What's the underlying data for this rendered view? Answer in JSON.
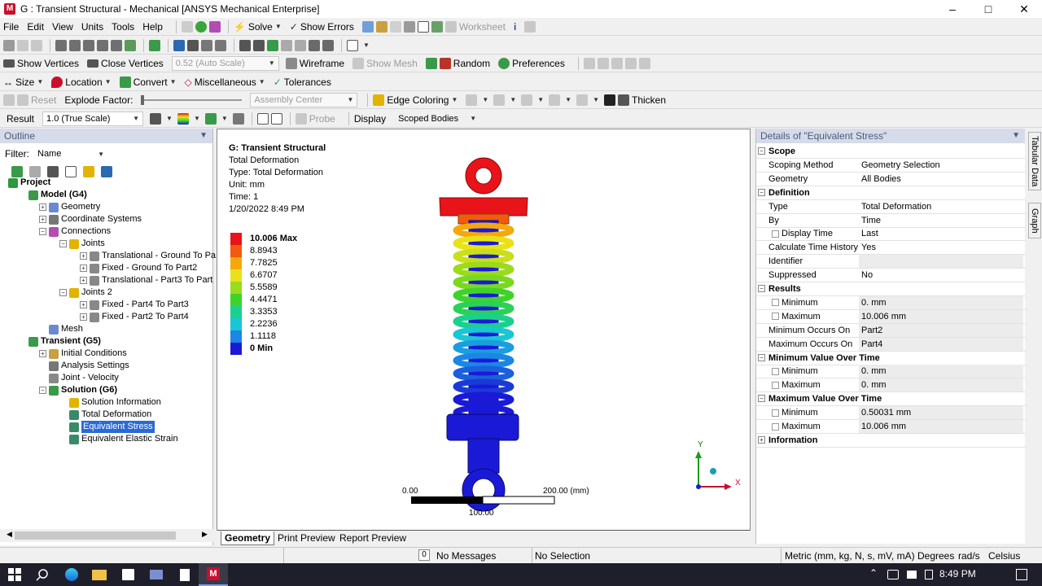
{
  "window": {
    "title": "G : Transient Structural - Mechanical [ANSYS Mechanical Enterprise]",
    "logo_letter": "M"
  },
  "menu": [
    "File",
    "Edit",
    "View",
    "Units",
    "Tools",
    "Help"
  ],
  "toolbar1": {
    "solve": "Solve",
    "show_errors": "Show Errors",
    "worksheet": "Worksheet"
  },
  "toolbar3": {
    "show_vertices": "Show Vertices",
    "close_vertices": "Close Vertices",
    "scale": "0.52 (Auto Scale)",
    "wireframe": "Wireframe",
    "show_mesh": "Show Mesh",
    "random": "Random",
    "preferences": "Preferences"
  },
  "toolbar4": {
    "size": "Size",
    "location": "Location",
    "convert": "Convert",
    "miscellaneous": "Miscellaneous",
    "tolerances": "Tolerances"
  },
  "toolbar5": {
    "reset": "Reset",
    "explode_factor": "Explode Factor:",
    "assembly_center": "Assembly Center",
    "edge_coloring": "Edge Coloring",
    "thicken": "Thicken"
  },
  "toolbar6": {
    "result_label": "Result",
    "result_scale": "1.0 (True Scale)",
    "probe": "Probe",
    "display_label": "Display",
    "display_value": "Scoped Bodies"
  },
  "outline": {
    "header": "Outline",
    "filter_label": "Filter:",
    "filter_value": "Name",
    "items": [
      {
        "label": "Project",
        "bold": true
      },
      {
        "label": "Model (G4)",
        "bold": true
      },
      {
        "label": "Geometry"
      },
      {
        "label": "Coordinate Systems"
      },
      {
        "label": "Connections"
      },
      {
        "label": "Joints"
      },
      {
        "label": "Translational - Ground To Pa"
      },
      {
        "label": "Fixed - Ground To Part2"
      },
      {
        "label": "Translational - Part3 To Part"
      },
      {
        "label": "Joints 2"
      },
      {
        "label": "Fixed - Part4 To Part3"
      },
      {
        "label": "Fixed - Part2 To Part4"
      },
      {
        "label": "Mesh"
      },
      {
        "label": "Transient (G5)",
        "bold": true
      },
      {
        "label": "Initial Conditions"
      },
      {
        "label": "Analysis Settings"
      },
      {
        "label": "Joint - Velocity"
      },
      {
        "label": "Solution (G6)",
        "bold": true
      },
      {
        "label": "Solution Information"
      },
      {
        "label": "Total Deformation"
      },
      {
        "label": "Equivalent Stress",
        "selected": true
      },
      {
        "label": "Equivalent Elastic Strain"
      }
    ]
  },
  "viewport": {
    "info": [
      "G: Transient Structural",
      "Total Deformation",
      "Type: Total Deformation",
      "Unit: mm",
      "Time: 1",
      "1/20/2022 8:49 PM"
    ],
    "legend": [
      {
        "label": "10.006 Max",
        "color": "#e8141a"
      },
      {
        "label": "8.8943",
        "color": "#f25a0d"
      },
      {
        "label": "7.7825",
        "color": "#f5a80a"
      },
      {
        "label": "6.6707",
        "color": "#e9e21a"
      },
      {
        "label": "5.5589",
        "color": "#9bdb1c"
      },
      {
        "label": "4.4471",
        "color": "#3fd32a"
      },
      {
        "label": "3.3353",
        "color": "#1bd08e"
      },
      {
        "label": "2.2236",
        "color": "#19c6d4"
      },
      {
        "label": "1.1118",
        "color": "#1a86e6"
      },
      {
        "label": "0 Min",
        "color": "#1a1ad6"
      }
    ],
    "scale": {
      "left": "0.00",
      "mid": "100.00",
      "right": "200.00 (mm)"
    },
    "axes": {
      "y": "Y",
      "x": "X"
    },
    "tabs": [
      "Geometry",
      "Print Preview",
      "Report Preview"
    ]
  },
  "details": {
    "header": "Details of \"Equivalent Stress\"",
    "rows": [
      {
        "type": "section",
        "key": "Scope"
      },
      {
        "key": "Scoping Method",
        "value": "Geometry Selection"
      },
      {
        "key": "Geometry",
        "value": "All Bodies"
      },
      {
        "type": "section",
        "key": "Definition"
      },
      {
        "key": "Type",
        "value": "Total Deformation"
      },
      {
        "key": "By",
        "value": "Time"
      },
      {
        "key": "Display Time",
        "value": "Last",
        "checkbox": true
      },
      {
        "key": "Calculate Time History",
        "value": "Yes"
      },
      {
        "key": "Identifier",
        "value": "",
        "shaded": true
      },
      {
        "key": "Suppressed",
        "value": "No"
      },
      {
        "type": "section",
        "key": "Results"
      },
      {
        "key": "Minimum",
        "value": "0. mm",
        "checkbox": true,
        "shaded": true
      },
      {
        "key": "Maximum",
        "value": "10.006 mm",
        "checkbox": true,
        "shaded": true
      },
      {
        "key": "Minimum Occurs On",
        "value": "Part2",
        "shaded": true
      },
      {
        "key": "Maximum Occurs On",
        "value": "Part4",
        "shaded": true
      },
      {
        "type": "section",
        "key": "Minimum Value Over Time"
      },
      {
        "key": "Minimum",
        "value": "0. mm",
        "checkbox": true,
        "shaded": true
      },
      {
        "key": "Maximum",
        "value": "0. mm",
        "checkbox": true,
        "shaded": true
      },
      {
        "type": "section",
        "key": "Maximum Value Over Time"
      },
      {
        "key": "Minimum",
        "value": "0.50031 mm",
        "checkbox": true,
        "shaded": true
      },
      {
        "key": "Maximum",
        "value": "10.006 mm",
        "checkbox": true,
        "shaded": true
      },
      {
        "type": "section",
        "key": "Information",
        "collapsed": true
      }
    ]
  },
  "side_tabs": [
    "Tabular Data",
    "Graph"
  ],
  "status": {
    "messages": "No Messages",
    "messages_count": "0",
    "selection": "No Selection",
    "units": "Metric (mm, kg, N, s, mV, mA)",
    "degrees": "Degrees",
    "rads": "rad/s",
    "temp": "Celsius"
  },
  "taskbar": {
    "time": "8:49 PM"
  }
}
